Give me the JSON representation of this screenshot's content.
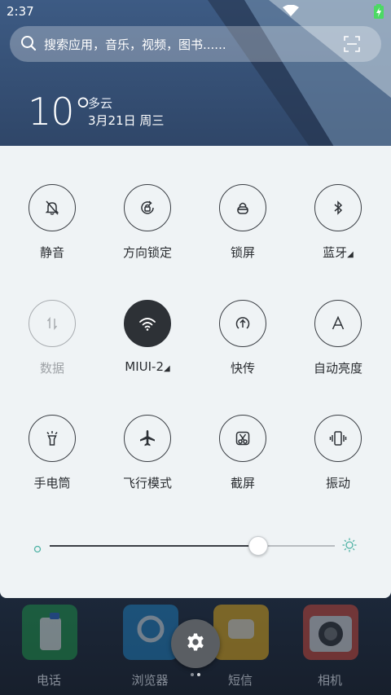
{
  "status_bar": {
    "time": "2:37"
  },
  "search": {
    "placeholder": "搜索应用，音乐，视频，图书......"
  },
  "weather": {
    "temperature": "10°",
    "condition": "多云",
    "date": "3月21日 周三"
  },
  "toggles": [
    {
      "label": "静音",
      "icon": "bell-off-icon",
      "state": "off",
      "has_submenu": false
    },
    {
      "label": "方向锁定",
      "icon": "rotation-lock-icon",
      "state": "off",
      "has_submenu": false
    },
    {
      "label": "锁屏",
      "icon": "lock-icon",
      "state": "off",
      "has_submenu": false
    },
    {
      "label": "蓝牙",
      "icon": "bluetooth-icon",
      "state": "off",
      "has_submenu": true
    },
    {
      "label": "数据",
      "icon": "mobile-data-icon",
      "state": "disabled",
      "has_submenu": false
    },
    {
      "label": "MIUI-2",
      "icon": "wifi-icon",
      "state": "on",
      "has_submenu": true
    },
    {
      "label": "快传",
      "icon": "quick-transfer-icon",
      "state": "off",
      "has_submenu": false
    },
    {
      "label": "自动亮度",
      "icon": "auto-brightness-icon",
      "state": "off",
      "has_submenu": false
    },
    {
      "label": "手电筒",
      "icon": "flashlight-icon",
      "state": "off",
      "has_submenu": false
    },
    {
      "label": "飞行模式",
      "icon": "airplane-icon",
      "state": "off",
      "has_submenu": false
    },
    {
      "label": "截屏",
      "icon": "screenshot-icon",
      "state": "off",
      "has_submenu": false
    },
    {
      "label": "振动",
      "icon": "vibrate-icon",
      "state": "off",
      "has_submenu": false
    }
  ],
  "brightness": {
    "level": 0.73
  },
  "dock": [
    {
      "label": "电话",
      "icon": "phone-app-icon",
      "color": "#1e9e4a"
    },
    {
      "label": "浏览器",
      "icon": "browser-app-icon",
      "color": "#1f86c9"
    },
    {
      "label": "短信",
      "icon": "messages-app-icon",
      "color": "#f0b418"
    },
    {
      "label": "相机",
      "icon": "camera-app-icon",
      "color": "#d94a3a"
    }
  ],
  "colors": {
    "panel_bg": "#eff3f5",
    "active_toggle": "#2d3136",
    "accent_teal": "#4fb3a5",
    "battery_green": "#4cd964"
  }
}
